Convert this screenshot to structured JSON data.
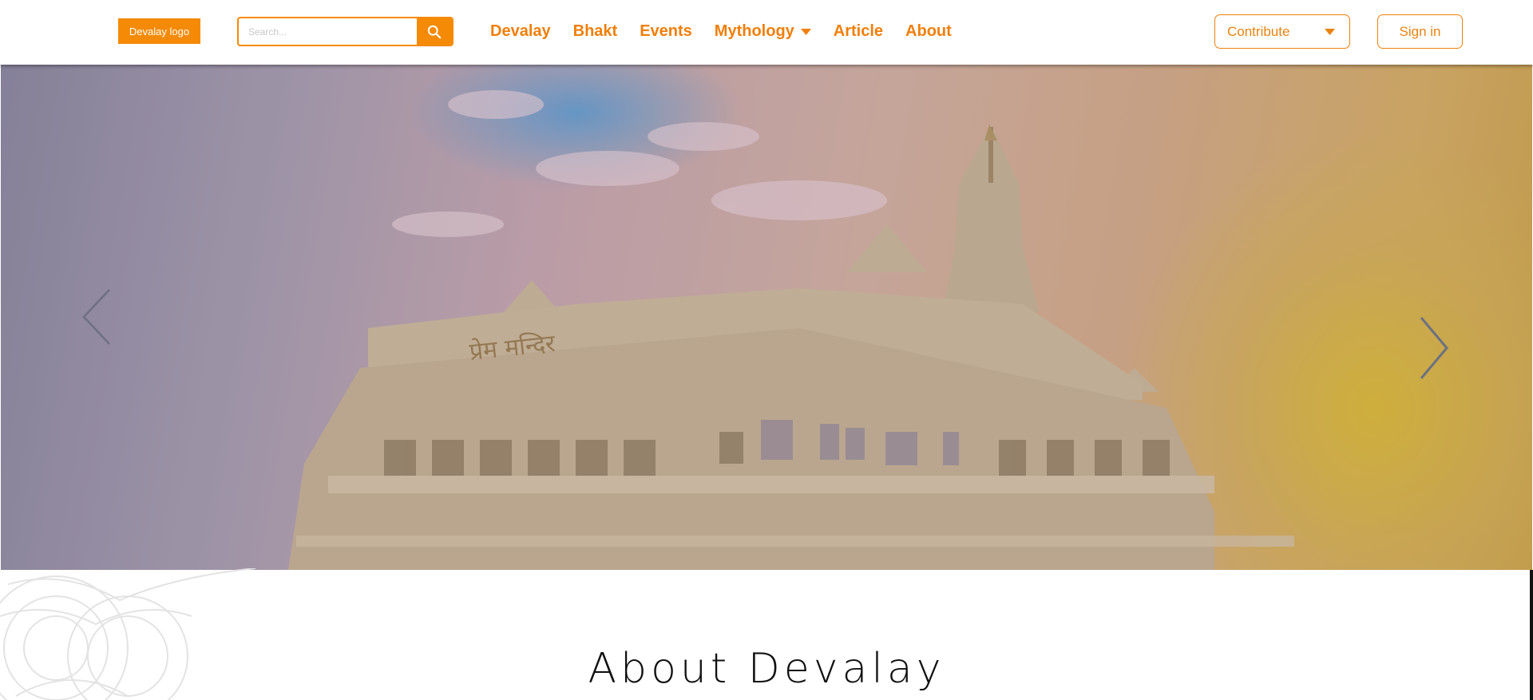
{
  "header": {
    "logo_text": "Devalay logo",
    "search": {
      "placeholder": "Search...",
      "icon": "search-icon"
    },
    "nav": [
      {
        "label": "Devalay"
      },
      {
        "label": "Bhakt"
      },
      {
        "label": "Events"
      },
      {
        "label": "Mythology",
        "has_dropdown": true
      },
      {
        "label": "Article"
      },
      {
        "label": "About"
      }
    ],
    "contribute_label": "Contribute",
    "signin_label": "Sign in"
  },
  "hero": {
    "temple_inscription": "प्रेम मन्दिर",
    "prev_icon": "chevron-left-icon",
    "next_icon": "chevron-right-icon"
  },
  "about": {
    "title": "About Devalay"
  },
  "colors": {
    "accent": "#f58a07",
    "nav_text": "#f07f0a",
    "title_text": "#111111"
  }
}
